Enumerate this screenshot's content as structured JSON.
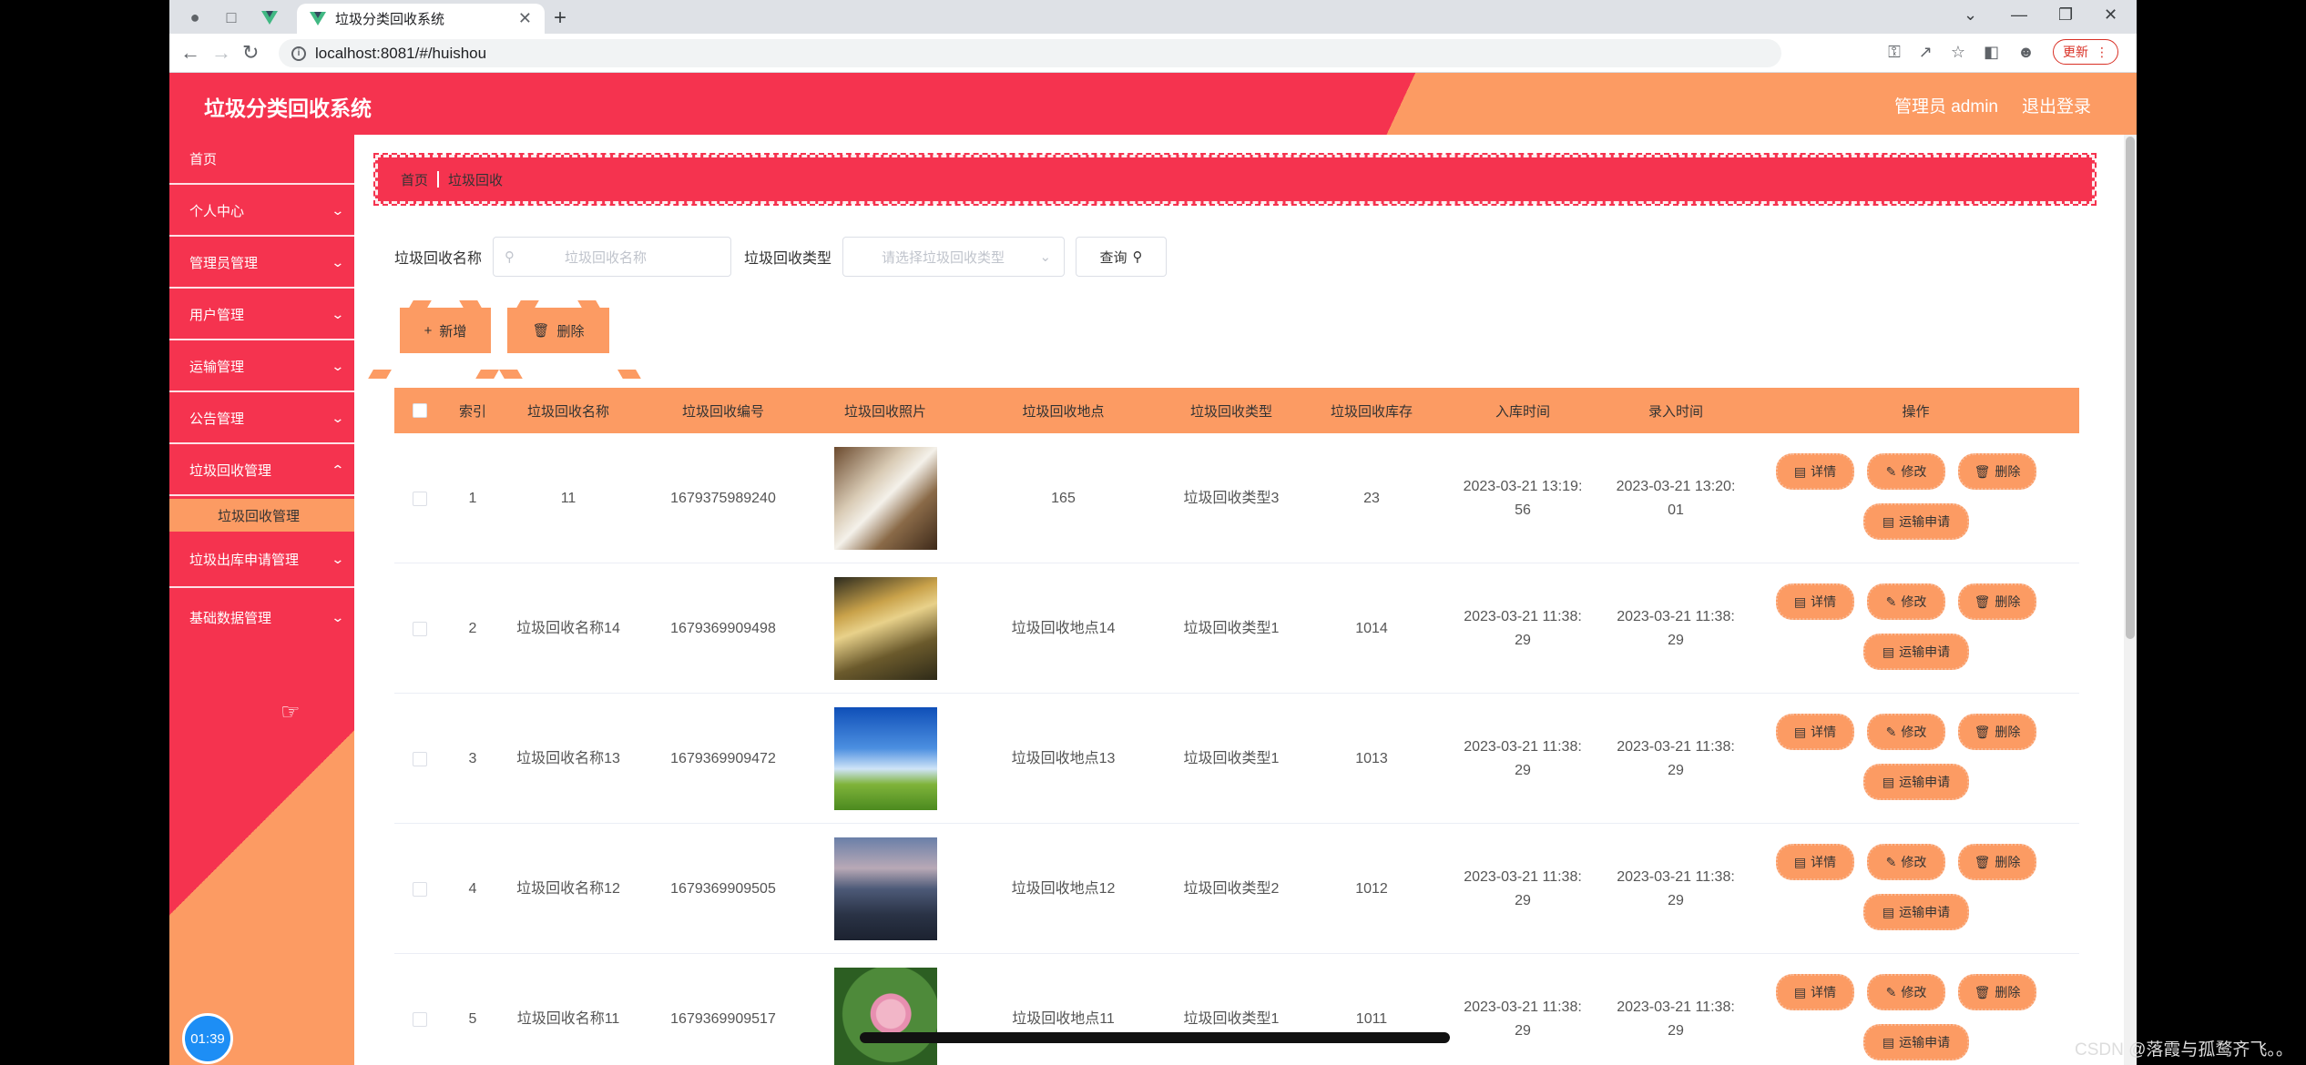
{
  "browser": {
    "tab_title": "垃圾分类回收系统",
    "url": "localhost:8081/#/huishou",
    "update_label": "更新"
  },
  "header": {
    "title": "垃圾分类回收系统",
    "user": "管理员 admin",
    "logout": "退出登录"
  },
  "sidebar": {
    "items": [
      {
        "label": "首页"
      },
      {
        "label": "个人中心"
      },
      {
        "label": "管理员管理"
      },
      {
        "label": "用户管理"
      },
      {
        "label": "运输管理"
      },
      {
        "label": "公告管理"
      },
      {
        "label": "垃圾回收管理"
      },
      {
        "label": "垃圾出库申请管理"
      },
      {
        "label": "基础数据管理"
      }
    ],
    "sub_item": "垃圾回收管理",
    "clock": "01:39"
  },
  "breadcrumb": {
    "home": "首页",
    "current": "垃圾回收"
  },
  "search": {
    "name_label": "垃圾回收名称",
    "name_placeholder": "垃圾回收名称",
    "type_label": "垃圾回收类型",
    "type_placeholder": "请选择垃圾回收类型",
    "query_label": "查询"
  },
  "actions": {
    "add": "新增",
    "delete": "删除"
  },
  "table": {
    "headers": [
      "索引",
      "垃圾回收名称",
      "垃圾回收编号",
      "垃圾回收照片",
      "垃圾回收地点",
      "垃圾回收类型",
      "垃圾回收库存",
      "入库时间",
      "录入时间",
      "操作"
    ],
    "rows": [
      {
        "index": "1",
        "name": "11",
        "code": "1679375989240",
        "place": "165",
        "type": "垃圾回收类型3",
        "stock": "23",
        "in_time_a": "2023-03-21 13:19:",
        "in_time_b": "56",
        "rec_time_a": "2023-03-21 13:20:",
        "rec_time_b": "01"
      },
      {
        "index": "2",
        "name": "垃圾回收名称14",
        "code": "1679369909498",
        "place": "垃圾回收地点14",
        "type": "垃圾回收类型1",
        "stock": "1014",
        "in_time_a": "2023-03-21 11:38:",
        "in_time_b": "29",
        "rec_time_a": "2023-03-21 11:38:",
        "rec_time_b": "29"
      },
      {
        "index": "3",
        "name": "垃圾回收名称13",
        "code": "1679369909472",
        "place": "垃圾回收地点13",
        "type": "垃圾回收类型1",
        "stock": "1013",
        "in_time_a": "2023-03-21 11:38:",
        "in_time_b": "29",
        "rec_time_a": "2023-03-21 11:38:",
        "rec_time_b": "29"
      },
      {
        "index": "4",
        "name": "垃圾回收名称12",
        "code": "1679369909505",
        "place": "垃圾回收地点12",
        "type": "垃圾回收类型2",
        "stock": "1012",
        "in_time_a": "2023-03-21 11:38:",
        "in_time_b": "29",
        "rec_time_a": "2023-03-21 11:38:",
        "rec_time_b": "29"
      },
      {
        "index": "5",
        "name": "垃圾回收名称11",
        "code": "1679369909517",
        "place": "垃圾回收地点11",
        "type": "垃圾回收类型1",
        "stock": "1011",
        "in_time_a": "2023-03-21 11:38:",
        "in_time_b": "29",
        "rec_time_a": "2023-03-21 11:38:",
        "rec_time_b": "29"
      }
    ],
    "ops": {
      "detail": "详情",
      "edit": "修改",
      "delete": "删除",
      "transport": "运输申请"
    }
  },
  "overlay": {
    "watermark": "CSDN @落霞与孤鹜齐飞。。"
  }
}
